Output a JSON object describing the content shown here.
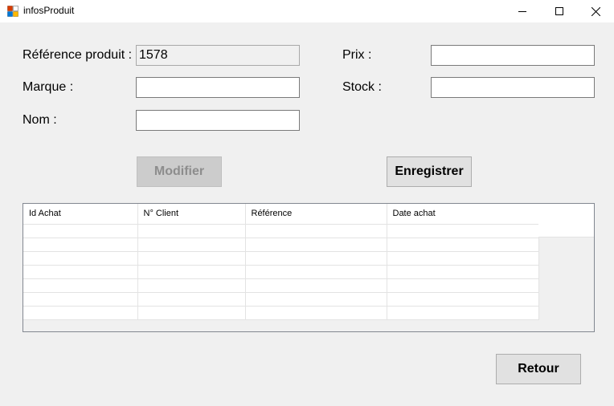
{
  "window": {
    "title": "infosProduit"
  },
  "form": {
    "reference_label": "Référence produit :",
    "reference_value": "1578",
    "marque_label": "Marque :",
    "marque_value": "",
    "nom_label": "Nom :",
    "nom_value": "",
    "prix_label": "Prix :",
    "prix_value": "",
    "stock_label": "Stock :",
    "stock_value": ""
  },
  "buttons": {
    "modifier": "Modifier",
    "enregistrer": "Enregistrer",
    "retour": "Retour"
  },
  "grid": {
    "columns": [
      "Id Achat",
      "N° Client",
      "Référence",
      "Date achat"
    ],
    "rows": []
  }
}
